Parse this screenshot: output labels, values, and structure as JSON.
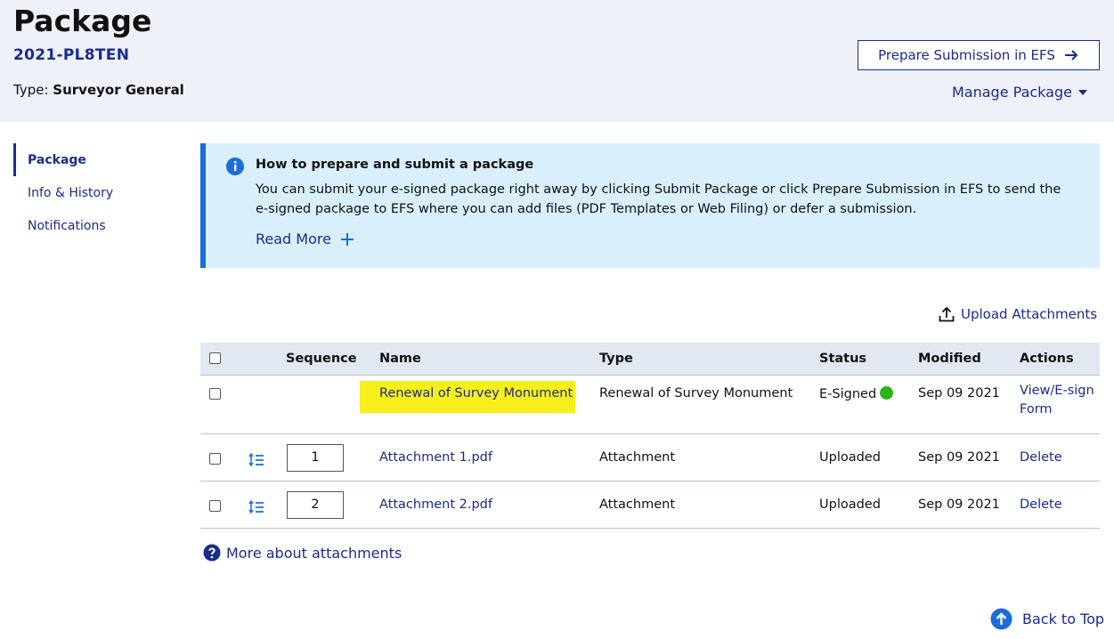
{
  "header": {
    "title": "Package",
    "package_id": "2021-PL8TEN",
    "type_label": "Type:",
    "type_value": "Surveyor General",
    "prepare_button": "Prepare Submission in EFS",
    "manage_package": "Manage Package"
  },
  "sidebar": {
    "items": [
      {
        "label": "Package",
        "active": true
      },
      {
        "label": "Info & History",
        "active": false
      },
      {
        "label": "Notifications",
        "active": false
      }
    ]
  },
  "info": {
    "title": "How to prepare and submit a package",
    "text": "You can submit your e-signed package right away by clicking Submit Package or click Prepare Submission in EFS to send the e-signed package to EFS where you can add files (PDF Templates or Web Filing) or defer a submission.",
    "read_more": "Read More"
  },
  "upload": {
    "label": "Upload Attachments"
  },
  "table": {
    "headers": [
      "Sequence",
      "Name",
      "Type",
      "Status",
      "Modified",
      "Actions"
    ],
    "rows": [
      {
        "sequence": "",
        "name": "Renewal of Survey Monument",
        "type": "Renewal of Survey Monument",
        "status": "E-Signed",
        "modified": "Sep 09 2021",
        "action": "View/E-sign Form"
      },
      {
        "sequence": "1",
        "name": "Attachment 1.pdf",
        "type": "Attachment",
        "status": "Uploaded",
        "modified": "Sep 09 2021",
        "action": "Delete"
      },
      {
        "sequence": "2",
        "name": "Attachment 2.pdf",
        "type": "Attachment",
        "status": "Uploaded",
        "modified": "Sep 09 2021",
        "action": "Delete"
      }
    ]
  },
  "footer": {
    "more_about": "More about attachments",
    "back_to_top": "Back to Top"
  },
  "colors": {
    "accent": "#1a2c8c",
    "info_bg": "#d9effc",
    "info_border": "#1a6ddb",
    "highlight": "#f6ef1c",
    "status_green": "#2fb31b"
  },
  "icons": [
    "arrow-right-icon",
    "caret-down-icon",
    "info-icon",
    "plus-icon",
    "upload-icon",
    "reorder-icon",
    "question-icon",
    "arrow-up-circle-icon"
  ]
}
